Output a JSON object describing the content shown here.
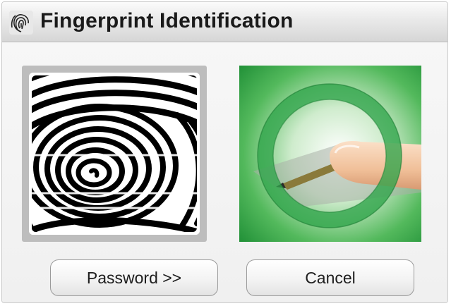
{
  "window": {
    "title": "Fingerprint Identification",
    "title_icon": "fingerprint-icon"
  },
  "scanner": {
    "image": "fingerprint-scan"
  },
  "illustration": {
    "image": "finger-on-sensor",
    "accent": "#3aa84f"
  },
  "buttons": {
    "password_label": "Password >>",
    "cancel_label": "Cancel"
  }
}
